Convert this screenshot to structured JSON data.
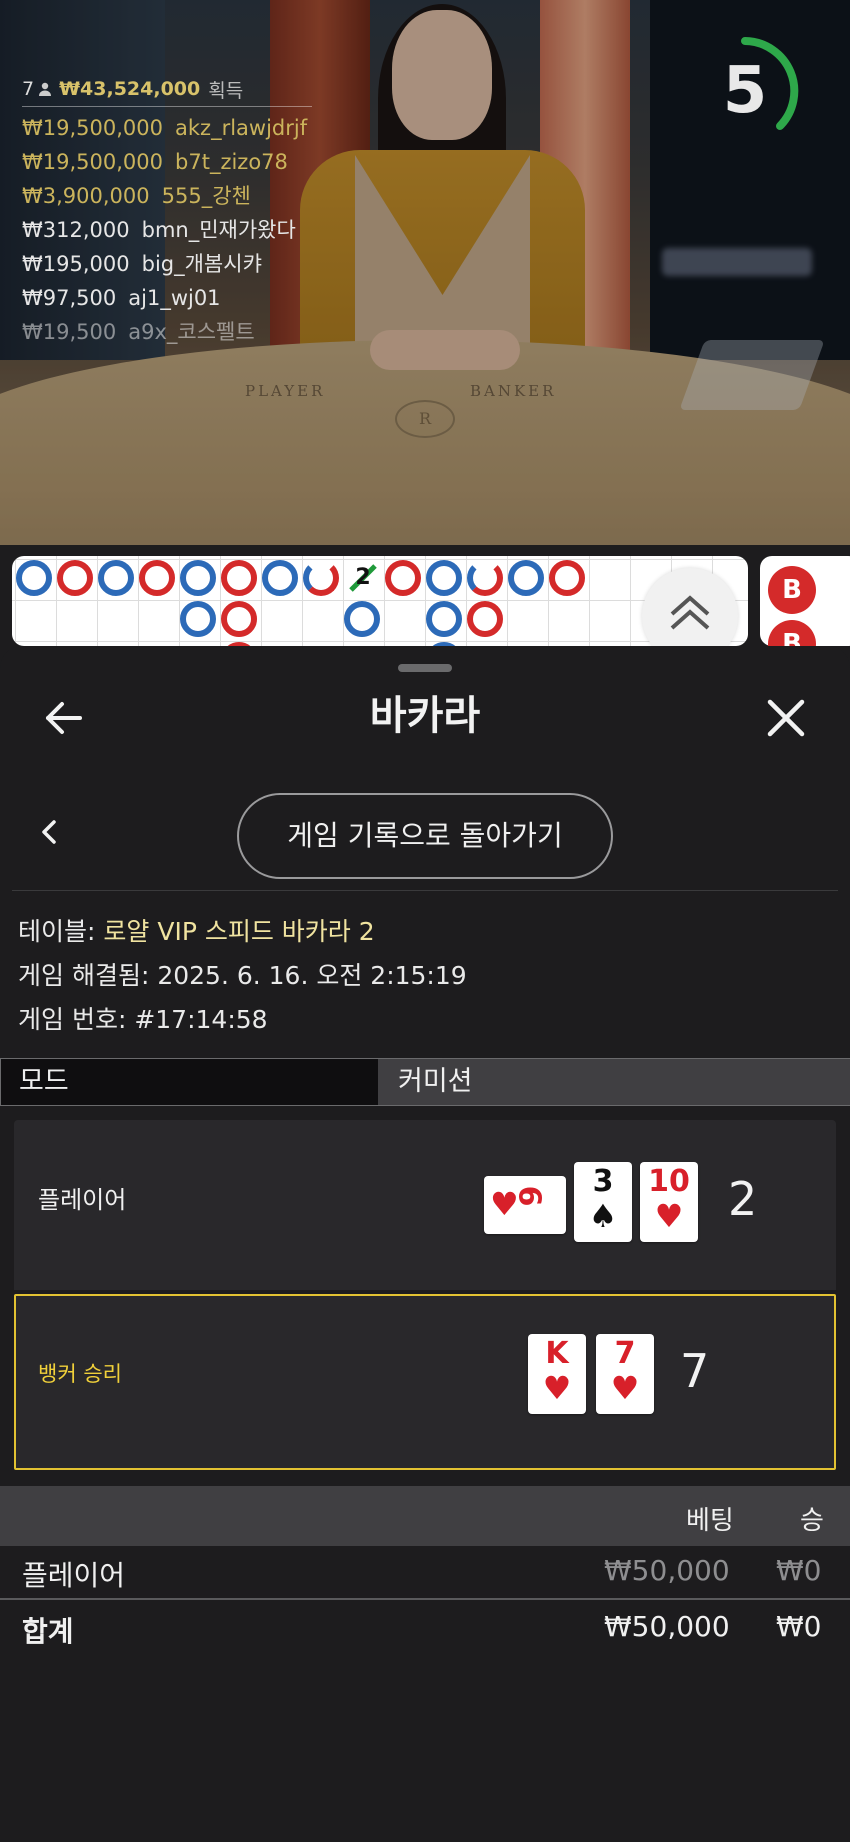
{
  "video": {
    "table_labels": {
      "player": "PLAYER",
      "banker": "BANKER",
      "crest": "R"
    },
    "countdown": 5,
    "countdown_color": "#2ea84a",
    "winners": {
      "count": "7",
      "person_icon": "person-icon",
      "total": "₩43,524,000",
      "total_label": "획득",
      "rows": [
        {
          "amount": "₩19,500,000",
          "name": "akz_rlawjdrjf",
          "style": "gold"
        },
        {
          "amount": "₩19,500,000",
          "name": "b7t_zizo78",
          "style": "gold"
        },
        {
          "amount": "₩3,900,000",
          "name": "555_강첸",
          "style": "gold"
        },
        {
          "amount": "₩312,000",
          "name": "bmn_민재가왔다",
          "style": "white"
        },
        {
          "amount": "₩195,000",
          "name": "big_개봄시캬",
          "style": "white"
        },
        {
          "amount": "₩97,500",
          "name": "aj1_wj01",
          "style": "white"
        },
        {
          "amount": "₩19,500",
          "name": "a9x_코스펠트",
          "style": "faded"
        }
      ]
    }
  },
  "roadmap": {
    "tie_number": "2",
    "side_badges": [
      "B",
      "B"
    ]
  },
  "sheet": {
    "title": "바카라",
    "back_to_history": "게임 기록으로 돌아가기",
    "info": {
      "table_label": "테이블:",
      "table_value": "로얄 VIP 스피드 바카라 2",
      "resolved_label": "게임 해결됨:",
      "resolved_value": "2025. 6. 16. 오전 2:15:19",
      "number_label": "게임 번호:",
      "number_value": "#17:14:58"
    },
    "tabs": {
      "mode": "모드",
      "commission": "커미션"
    },
    "player": {
      "label": "플레이어",
      "score": "2",
      "cards": [
        {
          "rank": "6",
          "suit": "♥",
          "color": "red"
        },
        {
          "rank": "3",
          "suit": "♠",
          "color": "black"
        },
        {
          "rank": "10",
          "suit": "♥",
          "color": "red"
        }
      ]
    },
    "banker": {
      "label": "뱅커 승리",
      "score": "7",
      "cards": [
        {
          "rank": "K",
          "suit": "♥",
          "color": "red"
        },
        {
          "rank": "7",
          "suit": "♥",
          "color": "red"
        }
      ]
    },
    "bets": {
      "col_bet": "베팅",
      "col_win": "승",
      "rows": [
        {
          "name": "플레이어",
          "bet": "₩50,000",
          "win": "₩0"
        }
      ],
      "total": {
        "name": "합계",
        "bet": "₩50,000",
        "win": "₩0"
      }
    },
    "highlight_color": "#e2c232"
  }
}
